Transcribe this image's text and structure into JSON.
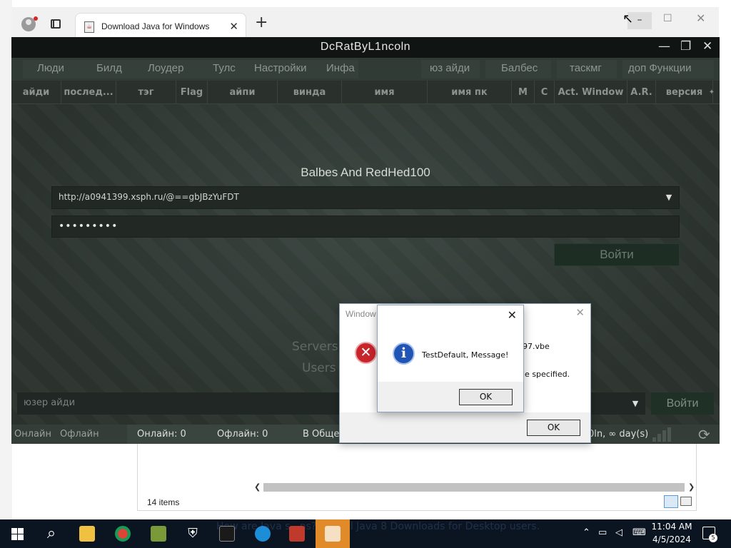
{
  "browser": {
    "tab_title": "Download Java for Windows",
    "new_tab": "+",
    "tab_close": "✕",
    "minimize": "–",
    "maximize": "☐",
    "close": "✕"
  },
  "app": {
    "title": "DcRatByL1ncoln",
    "controls": {
      "minimize": "—",
      "maximize": "❐",
      "close": "✕"
    },
    "menu": {
      "items": [
        "Люди",
        "Билд",
        "Лоудер",
        "Тулс",
        "Настройки",
        "Инфа"
      ],
      "right_items": [
        "юз айди",
        "Балбес",
        "таскмг",
        "доп Функции"
      ]
    },
    "columns": [
      "айди",
      "послед...",
      "тэг",
      "Flag",
      "айпи",
      "винда",
      "имя",
      "имя пк",
      "M",
      "C",
      "Act. Window",
      "A.R.",
      "версия"
    ],
    "login": {
      "heading": "Balbes And RedHed100",
      "url": "http://a0941399.xsph.ru/@==gbJBzYuFDT",
      "password_mask": "•••••••••",
      "button": "Войти"
    },
    "servers_label": "Servers",
    "users_label": "Users",
    "user_id_placeholder": "юзер айди",
    "user_id_button": "Войти",
    "status": {
      "online_tab": "Онлайн",
      "offline_tab": "Офлайн",
      "online_count": "Онлайн: 0",
      "offline_count": "Офлайн: 0",
      "total": "В Общем",
      "uptime": "0ln, ∞ day(s)"
    }
  },
  "explorer": {
    "items_count": "14 items"
  },
  "dialog_back": {
    "title": "Window",
    "text_line1": "97.vbe",
    "text_line2": "le specified.",
    "ok": "OK"
  },
  "dialog_front": {
    "message": "TestDefault, Message!",
    "ok": "OK",
    "close": "✕"
  },
  "taskbar": {
    "overlay_text": "How are Java s...ns? See all Java 8 Downloads for Desktop users.",
    "clock_time": "11:04 AM",
    "clock_date": "4/5/2024",
    "notification_count": "5"
  },
  "colors": {
    "app_bg": "#2c332f",
    "app_titlebar": "#101513",
    "taskbar": "#0b1522",
    "error_red": "#c8242b",
    "info_blue": "#2055b5"
  }
}
